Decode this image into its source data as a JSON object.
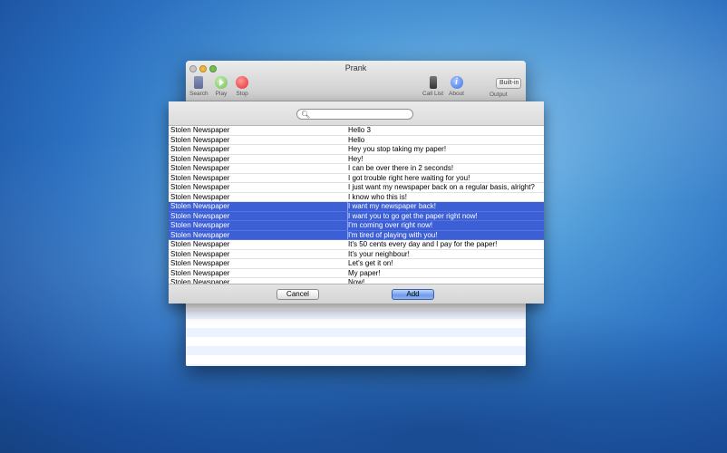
{
  "window": {
    "title": "Prank",
    "toolbar": {
      "search_label": "Search",
      "play_label": "Play",
      "stop_label": "Stop",
      "call_list_label": "Call List",
      "about_label": "About",
      "output_value": "Built-in O...",
      "output_label": "Output"
    }
  },
  "sheet": {
    "search": {
      "value": "",
      "placeholder": ""
    },
    "rows": [
      {
        "category": "Stolen Newspaper",
        "phrase": "Hello 3",
        "selected": false
      },
      {
        "category": "Stolen Newspaper",
        "phrase": "Hello",
        "selected": false
      },
      {
        "category": "Stolen Newspaper",
        "phrase": "Hey you stop taking my paper!",
        "selected": false
      },
      {
        "category": "Stolen Newspaper",
        "phrase": "Hey!",
        "selected": false
      },
      {
        "category": "Stolen Newspaper",
        "phrase": "I can be over there in 2 seconds!",
        "selected": false
      },
      {
        "category": "Stolen Newspaper",
        "phrase": "I got trouble right here waiting for you!",
        "selected": false
      },
      {
        "category": "Stolen Newspaper",
        "phrase": "I just want my newspaper back on a regular basis, alright?",
        "selected": false
      },
      {
        "category": "Stolen Newspaper",
        "phrase": "I know who this is!",
        "selected": false
      },
      {
        "category": "Stolen Newspaper",
        "phrase": "I want my newspaper back!",
        "selected": true
      },
      {
        "category": "Stolen Newspaper",
        "phrase": "I want you to go get the paper right now!",
        "selected": true
      },
      {
        "category": "Stolen Newspaper",
        "phrase": "I'm coming over right now!",
        "selected": true
      },
      {
        "category": "Stolen Newspaper",
        "phrase": "I'm tired of playing with you!",
        "selected": true
      },
      {
        "category": "Stolen Newspaper",
        "phrase": "It's 50 cents every day and I pay for the paper!",
        "selected": false
      },
      {
        "category": "Stolen Newspaper",
        "phrase": "It's your neighbour!",
        "selected": false
      },
      {
        "category": "Stolen Newspaper",
        "phrase": "Let's get it on!",
        "selected": false
      },
      {
        "category": "Stolen Newspaper",
        "phrase": "My paper!",
        "selected": false
      },
      {
        "category": "Stolen Newspaper",
        "phrase": "Now!",
        "selected": false
      }
    ],
    "cancel_label": "Cancel",
    "add_label": "Add"
  },
  "colors": {
    "selection": "#3d5fd6",
    "default_button": "#6f9ae8"
  }
}
